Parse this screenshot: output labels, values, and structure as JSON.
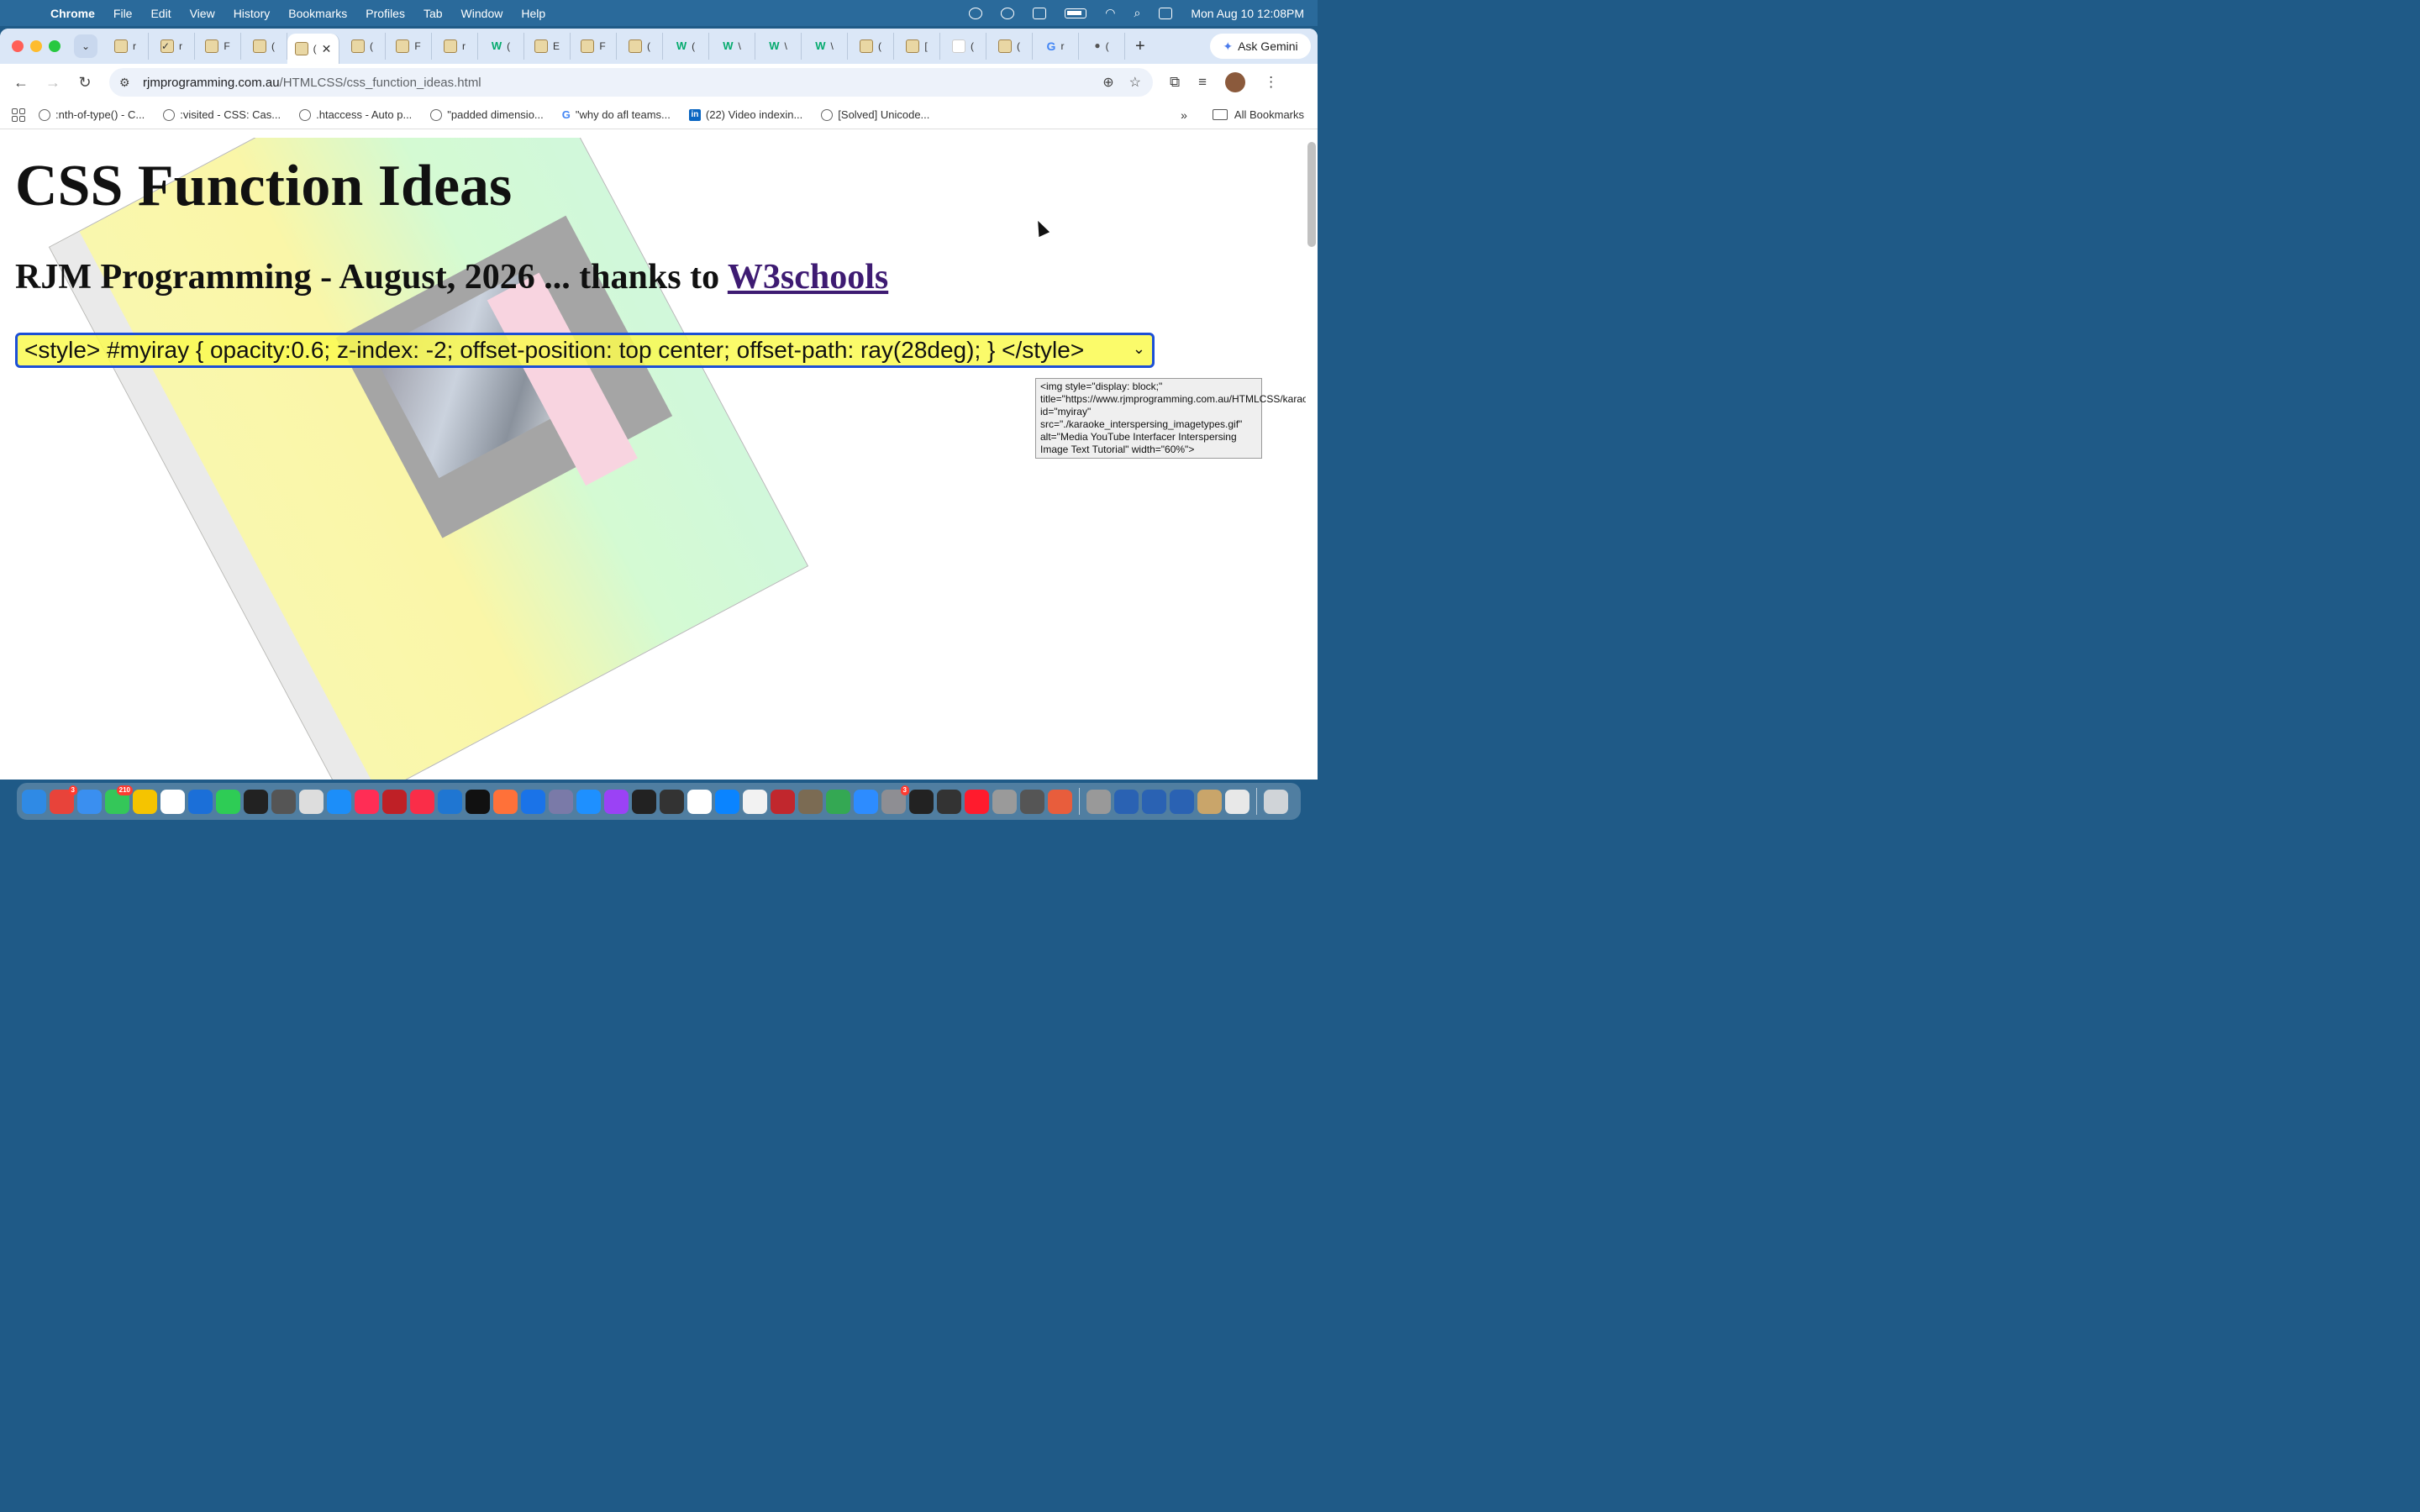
{
  "menubar": {
    "app": "Chrome",
    "items": [
      "File",
      "Edit",
      "View",
      "History",
      "Bookmarks",
      "Profiles",
      "Tab",
      "Window",
      "Help"
    ],
    "clock": "Mon Aug 10  12:08PM"
  },
  "tabs": [
    {
      "label": "r",
      "icon": "rjm-favicon"
    },
    {
      "label": "r",
      "icon": "check-favicon"
    },
    {
      "label": "F",
      "icon": "rjm-favicon"
    },
    {
      "label": "(",
      "icon": "rjm-favicon"
    },
    {
      "label": "(",
      "icon": "rjm-favicon",
      "active": true
    },
    {
      "label": "(",
      "icon": "rjm-favicon"
    },
    {
      "label": "F",
      "icon": "rjm-favicon"
    },
    {
      "label": "r",
      "icon": "rjm-favicon"
    },
    {
      "label": "(",
      "icon": "w3schools-favicon"
    },
    {
      "label": "E",
      "icon": "rjm-favicon"
    },
    {
      "label": "F",
      "icon": "rjm-favicon"
    },
    {
      "label": "(",
      "icon": "rjm-favicon"
    },
    {
      "label": "(",
      "icon": "w3schools-favicon"
    },
    {
      "label": "\\",
      "icon": "w3schools-favicon"
    },
    {
      "label": "\\",
      "icon": "w3schools-favicon"
    },
    {
      "label": "\\",
      "icon": "w3schools-favicon"
    },
    {
      "label": "(",
      "icon": "rjm-favicon"
    },
    {
      "label": "[",
      "icon": "rjm-favicon"
    },
    {
      "label": "(",
      "icon": "blank-favicon"
    },
    {
      "label": "(",
      "icon": "rjm-favicon"
    },
    {
      "label": "r",
      "icon": "google-favicon"
    },
    {
      "label": "(",
      "icon": "apple-favicon"
    }
  ],
  "gemini": {
    "label": "Ask Gemini"
  },
  "address": {
    "host": "rjmprogramming.com.au",
    "path": "/HTMLCSS/css_function_ideas.html"
  },
  "bookmarks": [
    {
      "label": ":nth-of-type() - C...",
      "icon": "globe-icon"
    },
    {
      "label": ":visited - CSS: Cas...",
      "icon": "globe-icon"
    },
    {
      "label": ".htaccess - Auto p...",
      "icon": "globe-icon"
    },
    {
      "label": "\"padded dimensio...",
      "icon": "globe-icon"
    },
    {
      "label": "\"why do afl teams...",
      "icon": "google-icon"
    },
    {
      "label": "(22) Video indexin...",
      "icon": "linkedin-icon"
    },
    {
      "label": "[Solved] Unicode...",
      "icon": "globe-icon"
    }
  ],
  "bookmarks_more": "»",
  "all_bookmarks": "All Bookmarks",
  "page": {
    "title": "CSS Function Ideas",
    "subtitle_prefix": "RJM Programming - August, 2026 ... thanks to ",
    "subtitle_link": "W3schools",
    "select_value": "<style> #myiray { opacity:0.6; z-index: -2; offset-position: top center; offset-path: ray(28deg); } </style>",
    "tooltip": "<img style=\"display: block;\" title=\"https://www.rjmprogramming.com.au/HTMLCSS/karaoke_interspersing_imagetypes.gif\" id=\"myiray\" src=\"./karaoke_interspersing_imagetypes.gif\" alt=\"Media YouTube Interfacer Interspersing Image Text Tutorial\" width=\"60%\">"
  },
  "dock": [
    {
      "name": "finder",
      "color": "#2f8ae5"
    },
    {
      "name": "launchpad",
      "color": "#e8433a",
      "badge": "3"
    },
    {
      "name": "mail",
      "color": "#3a8ff0"
    },
    {
      "name": "messages",
      "color": "#34c759",
      "badge": "210"
    },
    {
      "name": "notes",
      "color": "#f5c400"
    },
    {
      "name": "reminders",
      "color": "#ffffff"
    },
    {
      "name": "freeform",
      "color": "#1b6fd8"
    },
    {
      "name": "facetime",
      "color": "#2ecc55"
    },
    {
      "name": "terminal",
      "color": "#222222"
    },
    {
      "name": "calculator",
      "color": "#555555"
    },
    {
      "name": "preview",
      "color": "#dddddd"
    },
    {
      "name": "app-store",
      "color": "#1c8ef9"
    },
    {
      "name": "news",
      "color": "#ff2d55"
    },
    {
      "name": "filezilla",
      "color": "#bf2026"
    },
    {
      "name": "music",
      "color": "#fa2d48"
    },
    {
      "name": "xcode",
      "color": "#1f76d2"
    },
    {
      "name": "tv",
      "color": "#111111"
    },
    {
      "name": "firefox",
      "color": "#ff7139"
    },
    {
      "name": "xcode-tools",
      "color": "#1a73e8"
    },
    {
      "name": "bbedit",
      "color": "#7a7aa8"
    },
    {
      "name": "safari",
      "color": "#1e90ff"
    },
    {
      "name": "podcasts",
      "color": "#9b42f5"
    },
    {
      "name": "activity-monitor",
      "color": "#222222"
    },
    {
      "name": "console",
      "color": "#333333"
    },
    {
      "name": "calendar",
      "color": "#ffffff"
    },
    {
      "name": "quicktime",
      "color": "#0a84ff"
    },
    {
      "name": "textedit",
      "color": "#f2f2f2"
    },
    {
      "name": "sketchbook",
      "color": "#c1272d"
    },
    {
      "name": "gimp",
      "color": "#7b6b53"
    },
    {
      "name": "chrome",
      "color": "#34a853"
    },
    {
      "name": "zoom",
      "color": "#2d8cff"
    },
    {
      "name": "system-settings",
      "color": "#8e8e93",
      "badge": "3"
    },
    {
      "name": "inkscape",
      "color": "#222222"
    },
    {
      "name": "davinci",
      "color": "#333333"
    },
    {
      "name": "opera",
      "color": "#ff1b2d"
    },
    {
      "name": "contacts",
      "color": "#9a9a9a"
    },
    {
      "name": "gimp-2",
      "color": "#555555"
    },
    {
      "name": "pinwheel",
      "color": "#e85d3c"
    },
    {
      "name": "disk-utility",
      "color": "#999999"
    },
    {
      "name": "finder-2",
      "color": "#2a62b3"
    },
    {
      "name": "bluetooth",
      "color": "#2a62b3"
    },
    {
      "name": "migration",
      "color": "#2a62b3"
    },
    {
      "name": "archive",
      "color": "#c9a56a"
    },
    {
      "name": "screenshots",
      "color": "#e8e8e8"
    },
    {
      "name": "trash",
      "color": "#d0d4d8"
    }
  ]
}
